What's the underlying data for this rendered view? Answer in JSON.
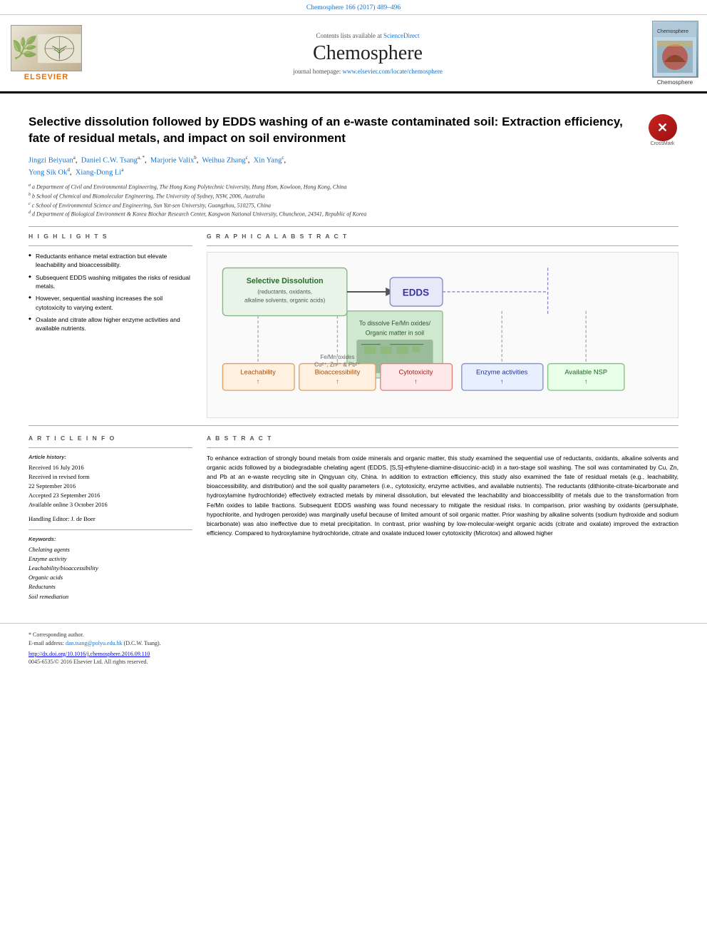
{
  "journal_ref": "Chemosphere 166 (2017) 489–496",
  "header": {
    "contents_available": "Contents lists available at",
    "sciencedirect": "ScienceDirect",
    "journal_name": "Chemosphere",
    "homepage_label": "journal homepage:",
    "homepage_url": "www.elsevier.com/locate/chemosphere",
    "elsevier_label": "ELSEVIER"
  },
  "article": {
    "title": "Selective dissolution followed by EDDS washing of an e-waste contaminated soil: Extraction efficiency, fate of residual metals, and impact on soil environment",
    "authors": "Jingzi Beiyuan a, Daniel C.W. Tsang a, *, Marjorie Valix b, Weihua Zhang c, Xin Yang c, Yong Sik Ok d, Xiang-Dong Li a",
    "affiliations": [
      "a Department of Civil and Environmental Engineering, The Hong Kong Polytechnic University, Hung Hom, Kowloon, Hong Kong, China",
      "b School of Chemical and Biomolecular Engineering, The University of Sydney, NSW, 2006, Australia",
      "c School of Environmental Science and Engineering, Sun Yat-sen University, Guangzhou, 510275, China",
      "d Department of Biological Environment & Korea Biochar Research Center, Kangwon National University, Chuncheon, 24341, Republic of Korea"
    ]
  },
  "highlights": {
    "section_title": "H I G H L I G H T S",
    "items": [
      "Reductants enhance metal extraction but elevate leachability and bioaccessibility.",
      "Subsequent EDDS washing mitigates the risks of residual metals.",
      "However, sequential washing increases the soil cytotoxicity to varying extent.",
      "Oxalate and citrate allow higher enzyme activities and available nutrients."
    ]
  },
  "graphical_abstract": {
    "section_title": "G R A P H I C A L   A B S T R A C T",
    "labels": {
      "selective_dissolution": "Selective Dissolution",
      "reductants_etc": "(reductants, oxidants, alkaline solvents, organic acids)",
      "edds": "EDDS",
      "dissolve_femnox": "To dissolve Fe/Mn oxides/",
      "organic_matter": "Organic matter in soil",
      "leachability": "Leachability",
      "bioaccessibility": "Bioaccessibility",
      "cytotoxicity": "Cytotoxicity",
      "fe_mn_oxides": "Fe/Mn oxides",
      "cu_zn_pb": "Cu²⁺, Zn²⁺ & Pb²⁺",
      "enzyme_activities": "Enzyme activities",
      "available_nsp": "Available NSP"
    }
  },
  "article_info": {
    "section_title": "A R T I C L E   I N F O",
    "history_label": "Article history:",
    "received": "Received 16 July 2016",
    "received_revised": "Received in revised form",
    "revised_date": "22 September 2016",
    "accepted": "Accepted 23 September 2016",
    "available": "Available online 3 October 2016",
    "handling_editor": "Handling Editor: J. de Boer",
    "keywords_label": "Keywords:",
    "keywords": [
      "Chelating agents",
      "Enzyme activity",
      "Leachability/bioaccessibility",
      "Organic acids",
      "Reductants",
      "Soil remediation"
    ]
  },
  "abstract": {
    "section_title": "A B S T R A C T",
    "text": "To enhance extraction of strongly bound metals from oxide minerals and organic matter, this study examined the sequential use of reductants, oxidants, alkaline solvents and organic acids followed by a biodegradable chelating agent (EDDS, [S,S]-ethylene-diamine-disuccinic-acid) in a two-stage soil washing. The soil was contaminated by Cu, Zn, and Pb at an e-waste recycling site in Qingyuan city, China. In addition to extraction efficiency, this study also examined the fate of residual metals (e.g., leachability, bioaccessibility, and distribution) and the soil quality parameters (i.e., cytotoxicity, enzyme activities, and available nutrients). The reductants (dithionite-citrate-bicarbonate and hydroxylamine hydrochloride) effectively extracted metals by mineral dissolution, but elevated the leachability and bioaccessibility of metals due to the transformation from Fe/Mn oxides to labile fractions. Subsequent EDDS washing was found necessary to mitigate the residual risks. In comparison, prior washing by oxidants (persulphate, hypochlorite, and hydrogen peroxide) was marginally useful because of limited amount of soil organic matter. Prior washing by alkaline solvents (sodium hydroxide and sodium bicarbonate) was also ineffective due to metal precipitation. In contrast, prior washing by low-molecular-weight organic acids (citrate and oxalate) improved the extraction efficiency. Compared to hydroxylamine hydrochloride, citrate and oxalate induced lower cytotoxicity (Microtox) and allowed higher"
  },
  "footer": {
    "corresponding_author_label": "* Corresponding author.",
    "email_label": "E-mail address:",
    "email": "dan.tsang@polyu.edu.hk",
    "email_suffix": "(D.C.W. Tsang).",
    "doi": "http://dx.doi.org/10.1016/j.chemosphere.2016.09.110",
    "issn_line": "0045-6535/© 2016 Elsevier Ltd. All rights reserved."
  }
}
